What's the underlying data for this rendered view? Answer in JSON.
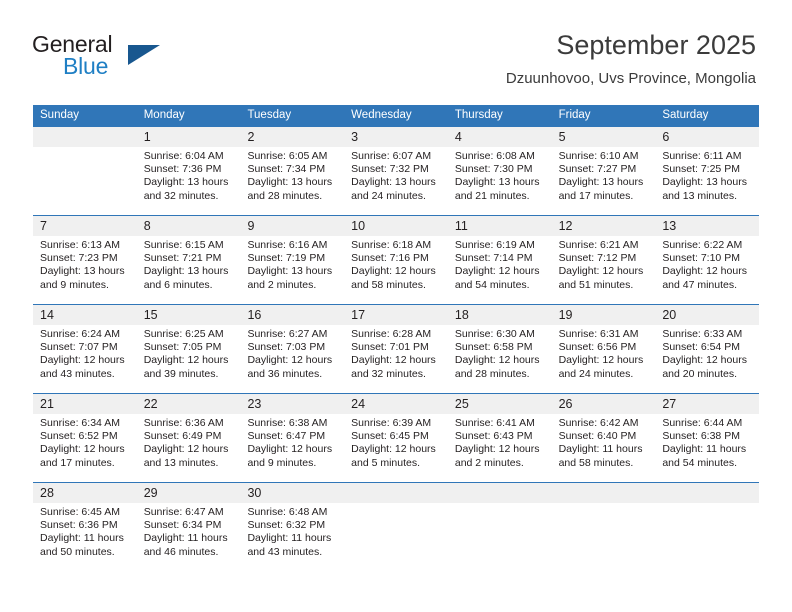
{
  "brand": {
    "word_one": "General",
    "word_two": "Blue",
    "triangle_color": "#18578f",
    "blue_color": "#1f7fc4"
  },
  "header": {
    "title": "September 2025",
    "subtitle": "Dzuunhovoo, Uvs Province, Mongolia"
  },
  "theme": {
    "header_blue": "#3076b8",
    "day_band_gray": "#f0f0f0",
    "text": "#231f20"
  },
  "weekday_headers": [
    "Sunday",
    "Monday",
    "Tuesday",
    "Wednesday",
    "Thursday",
    "Friday",
    "Saturday"
  ],
  "weeks": [
    {
      "days": [
        {
          "number": "",
          "lines": []
        },
        {
          "number": "1",
          "lines": [
            "Sunrise: 6:04 AM",
            "Sunset: 7:36 PM",
            "Daylight: 13 hours",
            "and 32 minutes."
          ]
        },
        {
          "number": "2",
          "lines": [
            "Sunrise: 6:05 AM",
            "Sunset: 7:34 PM",
            "Daylight: 13 hours",
            "and 28 minutes."
          ]
        },
        {
          "number": "3",
          "lines": [
            "Sunrise: 6:07 AM",
            "Sunset: 7:32 PM",
            "Daylight: 13 hours",
            "and 24 minutes."
          ]
        },
        {
          "number": "4",
          "lines": [
            "Sunrise: 6:08 AM",
            "Sunset: 7:30 PM",
            "Daylight: 13 hours",
            "and 21 minutes."
          ]
        },
        {
          "number": "5",
          "lines": [
            "Sunrise: 6:10 AM",
            "Sunset: 7:27 PM",
            "Daylight: 13 hours",
            "and 17 minutes."
          ]
        },
        {
          "number": "6",
          "lines": [
            "Sunrise: 6:11 AM",
            "Sunset: 7:25 PM",
            "Daylight: 13 hours",
            "and 13 minutes."
          ]
        }
      ]
    },
    {
      "days": [
        {
          "number": "7",
          "lines": [
            "Sunrise: 6:13 AM",
            "Sunset: 7:23 PM",
            "Daylight: 13 hours",
            "and 9 minutes."
          ]
        },
        {
          "number": "8",
          "lines": [
            "Sunrise: 6:15 AM",
            "Sunset: 7:21 PM",
            "Daylight: 13 hours",
            "and 6 minutes."
          ]
        },
        {
          "number": "9",
          "lines": [
            "Sunrise: 6:16 AM",
            "Sunset: 7:19 PM",
            "Daylight: 13 hours",
            "and 2 minutes."
          ]
        },
        {
          "number": "10",
          "lines": [
            "Sunrise: 6:18 AM",
            "Sunset: 7:16 PM",
            "Daylight: 12 hours",
            "and 58 minutes."
          ]
        },
        {
          "number": "11",
          "lines": [
            "Sunrise: 6:19 AM",
            "Sunset: 7:14 PM",
            "Daylight: 12 hours",
            "and 54 minutes."
          ]
        },
        {
          "number": "12",
          "lines": [
            "Sunrise: 6:21 AM",
            "Sunset: 7:12 PM",
            "Daylight: 12 hours",
            "and 51 minutes."
          ]
        },
        {
          "number": "13",
          "lines": [
            "Sunrise: 6:22 AM",
            "Sunset: 7:10 PM",
            "Daylight: 12 hours",
            "and 47 minutes."
          ]
        }
      ]
    },
    {
      "days": [
        {
          "number": "14",
          "lines": [
            "Sunrise: 6:24 AM",
            "Sunset: 7:07 PM",
            "Daylight: 12 hours",
            "and 43 minutes."
          ]
        },
        {
          "number": "15",
          "lines": [
            "Sunrise: 6:25 AM",
            "Sunset: 7:05 PM",
            "Daylight: 12 hours",
            "and 39 minutes."
          ]
        },
        {
          "number": "16",
          "lines": [
            "Sunrise: 6:27 AM",
            "Sunset: 7:03 PM",
            "Daylight: 12 hours",
            "and 36 minutes."
          ]
        },
        {
          "number": "17",
          "lines": [
            "Sunrise: 6:28 AM",
            "Sunset: 7:01 PM",
            "Daylight: 12 hours",
            "and 32 minutes."
          ]
        },
        {
          "number": "18",
          "lines": [
            "Sunrise: 6:30 AM",
            "Sunset: 6:58 PM",
            "Daylight: 12 hours",
            "and 28 minutes."
          ]
        },
        {
          "number": "19",
          "lines": [
            "Sunrise: 6:31 AM",
            "Sunset: 6:56 PM",
            "Daylight: 12 hours",
            "and 24 minutes."
          ]
        },
        {
          "number": "20",
          "lines": [
            "Sunrise: 6:33 AM",
            "Sunset: 6:54 PM",
            "Daylight: 12 hours",
            "and 20 minutes."
          ]
        }
      ]
    },
    {
      "days": [
        {
          "number": "21",
          "lines": [
            "Sunrise: 6:34 AM",
            "Sunset: 6:52 PM",
            "Daylight: 12 hours",
            "and 17 minutes."
          ]
        },
        {
          "number": "22",
          "lines": [
            "Sunrise: 6:36 AM",
            "Sunset: 6:49 PM",
            "Daylight: 12 hours",
            "and 13 minutes."
          ]
        },
        {
          "number": "23",
          "lines": [
            "Sunrise: 6:38 AM",
            "Sunset: 6:47 PM",
            "Daylight: 12 hours",
            "and 9 minutes."
          ]
        },
        {
          "number": "24",
          "lines": [
            "Sunrise: 6:39 AM",
            "Sunset: 6:45 PM",
            "Daylight: 12 hours",
            "and 5 minutes."
          ]
        },
        {
          "number": "25",
          "lines": [
            "Sunrise: 6:41 AM",
            "Sunset: 6:43 PM",
            "Daylight: 12 hours",
            "and 2 minutes."
          ]
        },
        {
          "number": "26",
          "lines": [
            "Sunrise: 6:42 AM",
            "Sunset: 6:40 PM",
            "Daylight: 11 hours",
            "and 58 minutes."
          ]
        },
        {
          "number": "27",
          "lines": [
            "Sunrise: 6:44 AM",
            "Sunset: 6:38 PM",
            "Daylight: 11 hours",
            "and 54 minutes."
          ]
        }
      ]
    },
    {
      "days": [
        {
          "number": "28",
          "lines": [
            "Sunrise: 6:45 AM",
            "Sunset: 6:36 PM",
            "Daylight: 11 hours",
            "and 50 minutes."
          ]
        },
        {
          "number": "29",
          "lines": [
            "Sunrise: 6:47 AM",
            "Sunset: 6:34 PM",
            "Daylight: 11 hours",
            "and 46 minutes."
          ]
        },
        {
          "number": "30",
          "lines": [
            "Sunrise: 6:48 AM",
            "Sunset: 6:32 PM",
            "Daylight: 11 hours",
            "and 43 minutes."
          ]
        },
        {
          "number": "",
          "lines": []
        },
        {
          "number": "",
          "lines": []
        },
        {
          "number": "",
          "lines": []
        },
        {
          "number": "",
          "lines": []
        }
      ]
    }
  ]
}
